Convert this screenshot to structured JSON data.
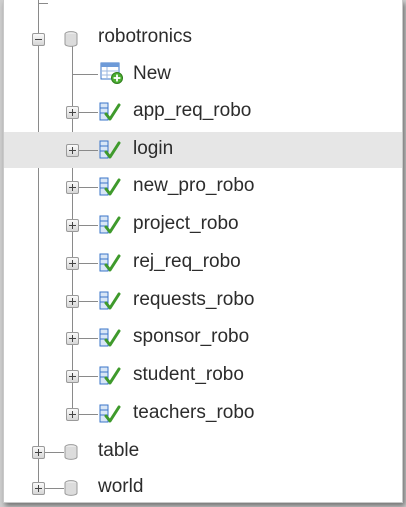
{
  "tree": {
    "database": {
      "name": "robotronics",
      "expanded": true,
      "new_label": "New",
      "tables": [
        {
          "name": "app_req_robo",
          "highlighted": false
        },
        {
          "name": "login",
          "highlighted": true
        },
        {
          "name": "new_pro_robo",
          "highlighted": false
        },
        {
          "name": "project_robo",
          "highlighted": false
        },
        {
          "name": "rej_req_robo",
          "highlighted": false
        },
        {
          "name": "requests_robo",
          "highlighted": false
        },
        {
          "name": "sponsor_robo",
          "highlighted": false
        },
        {
          "name": "student_robo",
          "highlighted": false
        },
        {
          "name": "teachers_robo",
          "highlighted": false
        }
      ]
    },
    "other_databases": [
      {
        "name": "table"
      },
      {
        "name": "world"
      }
    ]
  },
  "colors": {
    "highlight": "#e6e6e6",
    "table_icon_green": "#3f9a2c",
    "table_icon_blue": "#3a74c8",
    "new_icon_plus": "#4caf32"
  }
}
